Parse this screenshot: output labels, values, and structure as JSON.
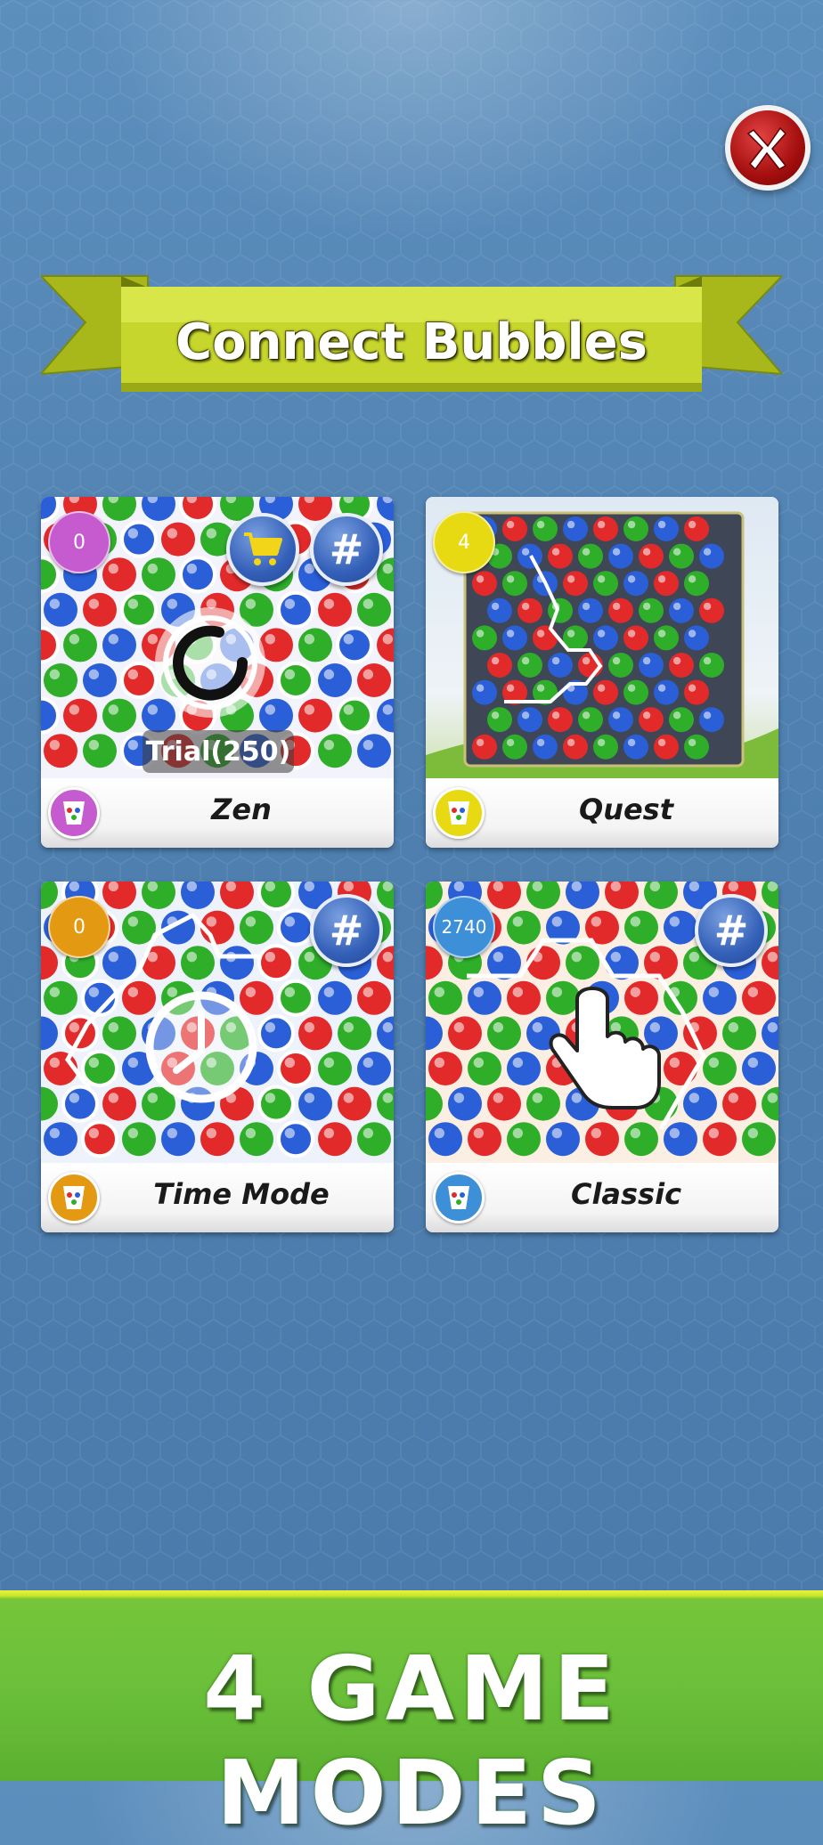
{
  "banner": {
    "title": "Connect Bubbles"
  },
  "close": {
    "label": "X"
  },
  "modes": [
    {
      "label": "Zen",
      "score": "0",
      "badge_color": "#c65bd0",
      "icon_color": "#c65bd0",
      "trial_label": "Trial(250)"
    },
    {
      "label": "Quest",
      "score": "4",
      "badge_color": "#e8da12",
      "icon_color": "#e8da12"
    },
    {
      "label": "Time Mode",
      "score": "0",
      "badge_color": "#e39a12",
      "icon_color": "#e39a12"
    },
    {
      "label": "Classic",
      "score": "2740",
      "badge_color": "#3d8fd8",
      "icon_color": "#3d8fd8"
    }
  ],
  "buttons": {
    "hash_label": "#"
  },
  "footer": {
    "title": "4 GAME MODES"
  },
  "colors": {
    "red": "#e32a2a",
    "green": "#2fae2a",
    "blue": "#2a5fd8"
  }
}
